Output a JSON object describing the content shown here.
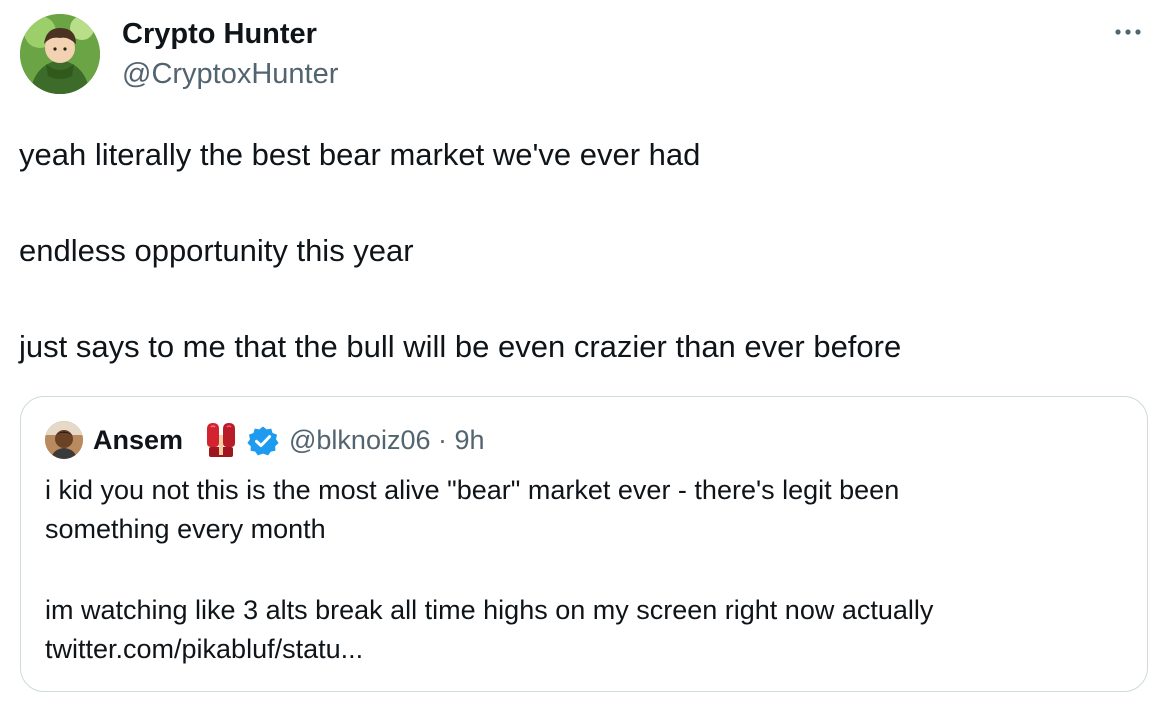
{
  "author": {
    "name": "Crypto Hunter",
    "handle": "@CryptoxHunter"
  },
  "tweet": {
    "paragraphs": [
      "yeah literally the best bear market we've ever had",
      "endless opportunity this year",
      "just says to me that the bull will be even crazier than ever before"
    ]
  },
  "quoted_tweet": {
    "name": "Ansem",
    "emoji_icon": "boxing-glove-icon",
    "verified_icon": "verified-badge-icon",
    "handle": "@blknoiz06",
    "separator": "·",
    "time": "9h",
    "text_lines": [
      "i kid you not this is the most alive \"bear\" market ever - there's legit been",
      "something every month",
      "im watching like 3 alts break all time highs on my screen right now actually",
      "twitter.com/pikabluf/statu..."
    ]
  },
  "icons": {
    "more": "more-options-icon"
  },
  "colors": {
    "text_primary": "#0f1419",
    "text_secondary": "#536471",
    "card_border": "#cfd9de",
    "verified_blue": "#1d9bf0",
    "glove_red": "#d32230"
  }
}
